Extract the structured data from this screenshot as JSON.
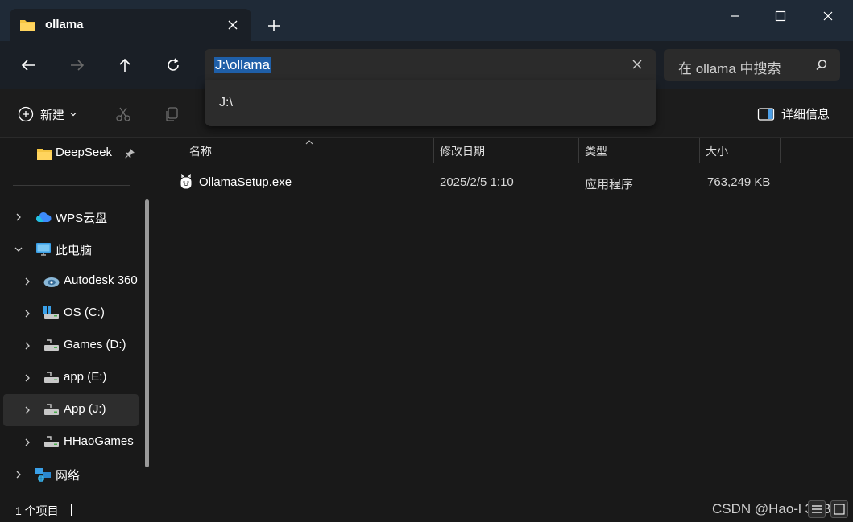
{
  "tab": {
    "title": "ollama",
    "icon": "folder-icon"
  },
  "window": {
    "minimize_icon": "minimize-icon",
    "maximize_icon": "maximize-icon",
    "close_icon": "close-icon"
  },
  "nav": {
    "address_value": "J:\\ollama",
    "search_placeholder": "在 ollama 中搜索",
    "dropdown_suggestion": "J:\\"
  },
  "toolbar": {
    "new_label": "新建",
    "details_label": "详细信息"
  },
  "sidebar": {
    "items": [
      {
        "label": "DeepSeek",
        "icon": "folder-icon",
        "pinned": true
      },
      {
        "label": "WPS云盘",
        "icon": "cloud-icon",
        "expanded": false
      },
      {
        "label": "此电脑",
        "icon": "computer-icon",
        "expanded": true
      },
      {
        "label": "Autodesk 360",
        "icon": "autodesk-icon",
        "expanded": false
      },
      {
        "label": "OS (C:)",
        "icon": "drive-icon",
        "expanded": false
      },
      {
        "label": "Games (D:)",
        "icon": "drive-icon",
        "expanded": false
      },
      {
        "label": "app (E:)",
        "icon": "drive-icon",
        "expanded": false
      },
      {
        "label": "App (J:)",
        "icon": "drive-icon",
        "expanded": false,
        "selected": true
      },
      {
        "label": "HHaoGames",
        "icon": "drive-icon",
        "expanded": false
      },
      {
        "label": "网络",
        "icon": "network-icon",
        "expanded": false
      }
    ]
  },
  "columns": {
    "name": "名称",
    "modified": "修改日期",
    "type": "类型",
    "size": "大小"
  },
  "files": [
    {
      "name": "OllamaSetup.exe",
      "modified": "2025/2/5 1:10",
      "type": "应用程序",
      "size": "763,249 KB",
      "icon": "ollama-app-icon"
    }
  ],
  "status": {
    "count_text": "1 个项目",
    "watermark": "CSDN @Hao-l 3BB"
  },
  "colors": {
    "accent": "#4da0e8",
    "selection": "#1f5fa8",
    "titlebar": "#1f2a37"
  }
}
